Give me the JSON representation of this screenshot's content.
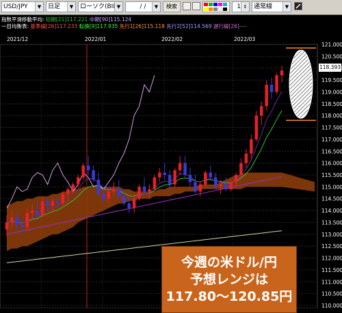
{
  "toolbar": {
    "pair": "USD/JPY",
    "timeframe": "日足",
    "price_type": "ローソク(BID)",
    "date_input": "/  /",
    "search_label": "検索",
    "spin_value": "1",
    "line_style": "通常線"
  },
  "indicators": {
    "sma": {
      "label": "指数平滑移動平均:",
      "short": "短期[21]117.221",
      "mid": "中期[90]115.124"
    },
    "ichimoku": {
      "label": "一目均衡表:",
      "kijun": "基準線[26]117.233",
      "tenkan": "転換[9]117.935",
      "senkou1": "先行1[26]115.118",
      "senkou2": "先行2[52]114.569",
      "chikou": "遅行線[26]----"
    }
  },
  "dates": [
    "2021/12",
    "2022/01",
    "2022/02",
    "2022/03"
  ],
  "price_axis": [
    "121.000",
    "120.500",
    "120.000",
    "119.500",
    "119.000",
    "118.500",
    "118.000",
    "117.500",
    "117.000",
    "116.500",
    "116.000",
    "115.500",
    "115.000",
    "114.500",
    "114.000",
    "113.500",
    "113.000",
    "112.500",
    "112.000",
    "111.500",
    "111.000",
    "110.500",
    "110.000"
  ],
  "current_price": "118.393",
  "forecast": {
    "line1": "今週の米ドル/円",
    "line2": "予想レンジは",
    "line3": "117.80〜120.85円",
    "high": 120.85,
    "low": 117.8
  },
  "colors": {
    "up_candle": "#e8202a",
    "down_candle": "#3a3ad8",
    "kumo": "#8a3c0a",
    "sma_short": "#2fc42f",
    "sma_mid": "#9a30c8",
    "kijun": "#c890e0",
    "tenkan": "#6a2a9a",
    "chikou": "#d8a0e8",
    "long_ma": "#d8d8a8",
    "forecast_box": "#c8641c"
  },
  "chart_data": {
    "type": "candlestick",
    "ylim": [
      110.0,
      121.0
    ],
    "candles": [
      [
        113.2,
        113.8,
        112.9,
        113.5
      ],
      [
        113.5,
        114.0,
        113.3,
        113.7
      ],
      [
        113.7,
        113.9,
        113.2,
        113.4
      ],
      [
        113.4,
        113.7,
        113.0,
        113.3
      ],
      [
        113.3,
        114.1,
        113.2,
        113.9
      ],
      [
        113.9,
        114.3,
        113.6,
        114.0
      ],
      [
        114.0,
        114.4,
        113.7,
        113.8
      ],
      [
        113.8,
        114.6,
        113.7,
        114.4
      ],
      [
        114.4,
        114.6,
        114.0,
        114.2
      ],
      [
        114.2,
        114.5,
        113.9,
        114.4
      ],
      [
        114.4,
        114.6,
        114.1,
        114.3
      ],
      [
        114.3,
        114.8,
        114.2,
        114.7
      ],
      [
        114.7,
        115.0,
        114.4,
        114.9
      ],
      [
        114.9,
        115.2,
        114.7,
        115.1
      ],
      [
        115.1,
        115.5,
        115.0,
        115.4
      ],
      [
        115.4,
        116.0,
        115.3,
        115.9
      ],
      [
        115.9,
        116.3,
        115.5,
        115.7
      ],
      [
        115.7,
        115.9,
        115.2,
        115.3
      ],
      [
        115.3,
        115.6,
        114.6,
        114.7
      ],
      [
        114.7,
        115.0,
        114.3,
        114.5
      ],
      [
        114.5,
        114.9,
        114.3,
        114.8
      ],
      [
        114.8,
        115.2,
        114.6,
        114.9
      ],
      [
        114.9,
        115.3,
        114.5,
        114.6
      ],
      [
        114.6,
        114.9,
        114.2,
        114.3
      ],
      [
        114.3,
        114.5,
        113.9,
        114.1
      ],
      [
        114.1,
        114.7,
        113.9,
        114.5
      ],
      [
        114.5,
        115.1,
        114.4,
        115.0
      ],
      [
        115.0,
        115.4,
        114.7,
        114.8
      ],
      [
        114.8,
        115.1,
        114.5,
        114.9
      ],
      [
        114.9,
        115.5,
        114.8,
        115.4
      ],
      [
        115.4,
        115.8,
        115.2,
        115.6
      ],
      [
        115.6,
        116.0,
        115.3,
        115.5
      ],
      [
        115.5,
        115.7,
        114.9,
        115.1
      ],
      [
        115.1,
        115.8,
        115.0,
        115.7
      ],
      [
        115.7,
        116.3,
        115.5,
        116.0
      ],
      [
        116.0,
        116.3,
        115.4,
        115.5
      ],
      [
        115.5,
        115.8,
        115.0,
        115.2
      ],
      [
        115.2,
        115.5,
        114.7,
        114.8
      ],
      [
        114.8,
        115.2,
        114.6,
        115.1
      ],
      [
        115.1,
        115.7,
        115.0,
        115.6
      ],
      [
        115.6,
        115.9,
        115.3,
        115.4
      ],
      [
        115.4,
        115.6,
        114.9,
        115.0
      ],
      [
        115.0,
        115.3,
        114.7,
        115.1
      ],
      [
        115.1,
        115.4,
        114.8,
        114.9
      ],
      [
        114.9,
        115.3,
        114.8,
        115.2
      ],
      [
        115.2,
        115.6,
        115.0,
        115.5
      ],
      [
        115.5,
        116.2,
        115.4,
        116.0
      ],
      [
        116.0,
        116.6,
        115.8,
        116.4
      ],
      [
        116.4,
        117.2,
        116.2,
        117.0
      ],
      [
        117.0,
        118.2,
        116.9,
        118.0
      ],
      [
        118.0,
        118.6,
        117.6,
        118.4
      ],
      [
        118.4,
        119.5,
        118.2,
        119.3
      ],
      [
        119.3,
        119.6,
        118.7,
        119.0
      ],
      [
        119.0,
        119.8,
        118.9,
        119.7
      ],
      [
        119.7,
        120.1,
        119.4,
        119.9
      ]
    ],
    "forecast_range": [
      117.8,
      120.85
    ]
  }
}
